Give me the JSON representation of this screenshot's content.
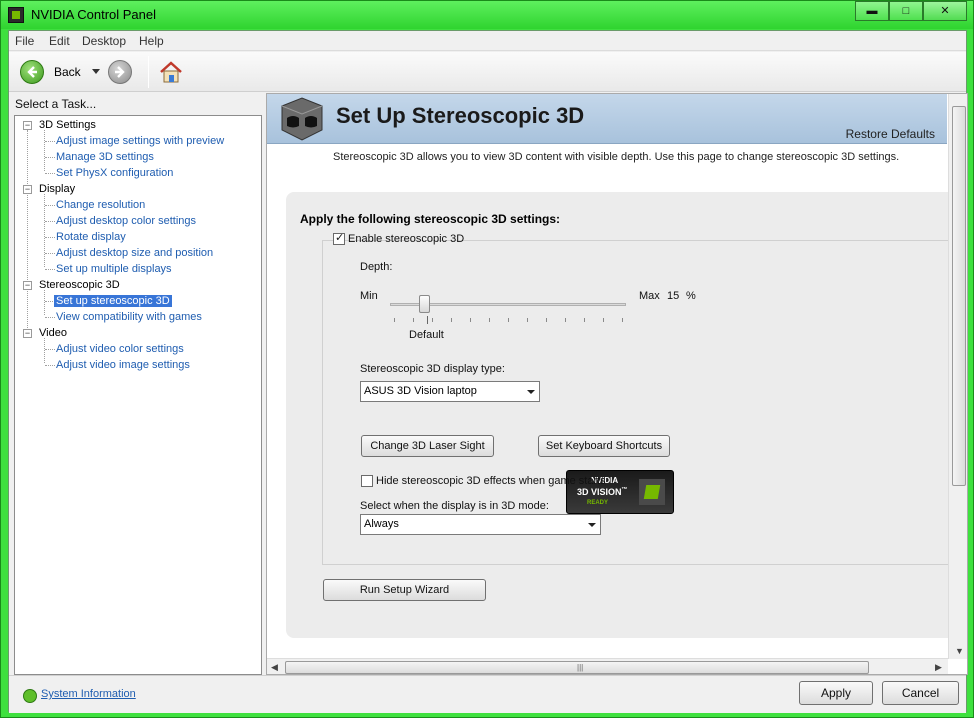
{
  "window": {
    "title": "NVIDIA Control Panel"
  },
  "window_controls": {
    "minimize": "▬",
    "maximize": "□",
    "close": "✕"
  },
  "menu": [
    "File",
    "Edit",
    "Desktop",
    "Help"
  ],
  "toolbar": {
    "back_label": "Back"
  },
  "left_pane": {
    "caption": "Select a Task..."
  },
  "tree": {
    "categories": [
      {
        "label": "3D Settings",
        "items": [
          "Adjust image settings with preview",
          "Manage 3D settings",
          "Set PhysX configuration"
        ]
      },
      {
        "label": "Display",
        "items": [
          "Change resolution",
          "Adjust desktop color settings",
          "Rotate display",
          "Adjust desktop size and position",
          "Set up multiple displays"
        ]
      },
      {
        "label": "Stereoscopic 3D",
        "items": [
          "Set up stereoscopic 3D",
          "View compatibility with games"
        ]
      },
      {
        "label": "Video",
        "items": [
          "Adjust video color settings",
          "Adjust video image settings"
        ]
      }
    ],
    "selected": "Set up stereoscopic 3D"
  },
  "page": {
    "title": "Set Up Stereoscopic 3D",
    "restore_defaults": "Restore Defaults",
    "description": "Stereoscopic 3D allows you to view 3D content with visible depth. Use this page to change stereoscopic 3D settings.",
    "section_title": "Apply the following stereoscopic 3D settings:",
    "enable_label": "Enable stereoscopic 3D",
    "enable_checked": true,
    "depth": {
      "label": "Depth:",
      "min_label": "Min",
      "max_label": "Max",
      "value": "15",
      "unit": "%",
      "default_label": "Default",
      "position": 0.15
    },
    "display_type": {
      "label": "Stereoscopic 3D display type:",
      "selected": "ASUS 3D Vision laptop"
    },
    "badge": {
      "brand": "NVIDIA",
      "product": "3D VISION",
      "trademark": "™",
      "status": "READY"
    },
    "laser_sight_button": "Change 3D Laser Sight",
    "keyboard_shortcuts_button": "Set Keyboard Shortcuts",
    "hide_effects_label": "Hide stereoscopic 3D effects when game starts",
    "hide_effects_checked": false,
    "mode": {
      "label": "Select when the display is in 3D mode:",
      "selected": "Always"
    },
    "wizard_button": "Run Setup Wizard"
  },
  "footer": {
    "system_info": "System Information",
    "apply": "Apply",
    "cancel": "Cancel"
  },
  "colors": {
    "window_frame": "#3ee03e",
    "link": "#1f5db0",
    "selection": "#3875d7",
    "banner": "#b4cbe2",
    "nvidia_green": "#76b900"
  }
}
